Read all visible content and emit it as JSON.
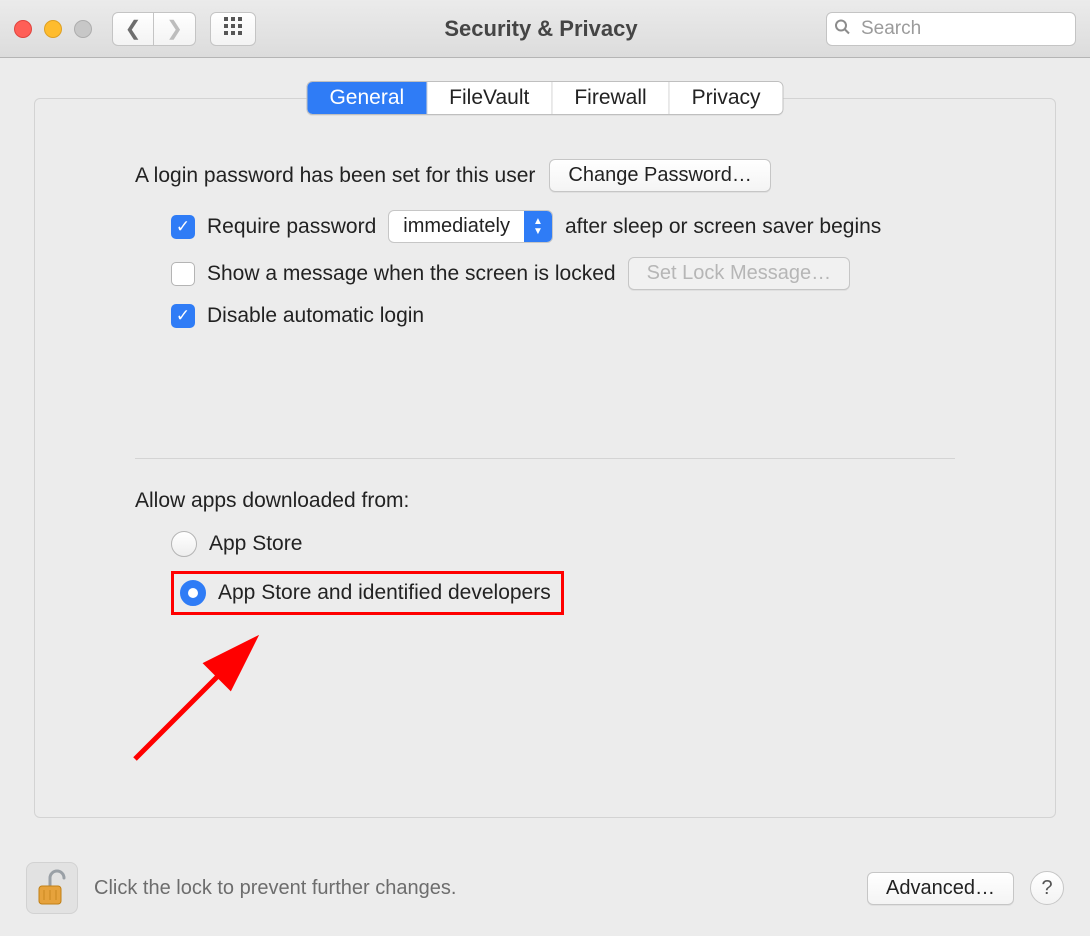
{
  "window": {
    "title": "Security & Privacy"
  },
  "toolbar": {
    "search_placeholder": "Search"
  },
  "tabs": [
    {
      "label": "General",
      "active": true
    },
    {
      "label": "FileVault",
      "active": false
    },
    {
      "label": "Firewall",
      "active": false
    },
    {
      "label": "Privacy",
      "active": false
    }
  ],
  "general": {
    "login_password_text": "A login password has been set for this user",
    "change_password_button": "Change Password…",
    "require_password_label": "Require password",
    "require_password_checked": true,
    "require_password_delay": "immediately",
    "require_password_suffix": "after sleep or screen saver begins",
    "show_message_label": "Show a message when the screen is locked",
    "show_message_checked": false,
    "set_lock_message_button": "Set Lock Message…",
    "disable_auto_login_label": "Disable automatic login",
    "disable_auto_login_checked": true,
    "allow_apps_label": "Allow apps downloaded from:",
    "radio_app_store": "App Store",
    "radio_identified": "App Store and identified developers",
    "radio_selected": "identified"
  },
  "footer": {
    "lock_hint": "Click the lock to prevent further changes.",
    "advanced_button": "Advanced…",
    "help_label": "?"
  }
}
